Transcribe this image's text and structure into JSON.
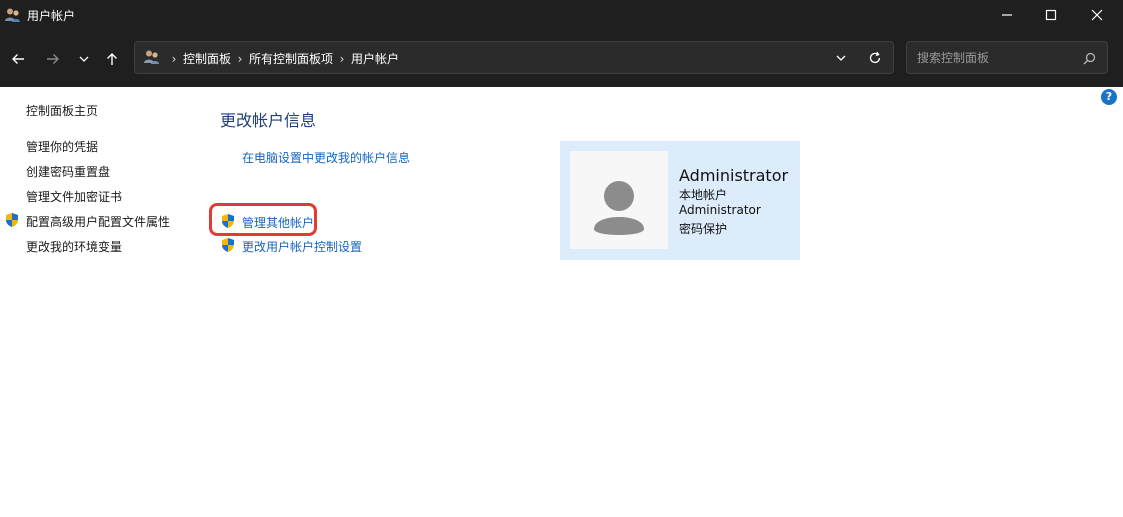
{
  "window": {
    "title": "用户帐户",
    "controls": {
      "minimize": "minimize",
      "maximize": "maximize",
      "close": "close"
    }
  },
  "address": {
    "breadcrumbs": [
      "控制面板",
      "所有控制面板项",
      "用户帐户"
    ]
  },
  "search": {
    "placeholder": "搜索控制面板"
  },
  "help": {
    "label": "?"
  },
  "sidebar": {
    "home": "控制面板主页",
    "items": [
      {
        "label": "管理你的凭据"
      },
      {
        "label": "创建密码重置盘"
      },
      {
        "label": "管理文件加密证书"
      },
      {
        "label": "配置高级用户配置文件属性",
        "icon": "uac-shield-icon"
      },
      {
        "label": "更改我的环境变量"
      }
    ]
  },
  "main": {
    "title": "更改帐户信息",
    "links": [
      {
        "label": "在电脑设置中更改我的帐户信息"
      },
      {
        "label": "管理其他帐户",
        "icon": "uac-shield-icon",
        "highlighted": true
      },
      {
        "label": "更改用户帐户控制设置",
        "icon": "uac-shield-icon"
      }
    ]
  },
  "account": {
    "name": "Administrator",
    "type": "本地帐户",
    "group": "Administrator",
    "status": "密码保护"
  },
  "colors": {
    "titlebar": "#1f1f1f",
    "link": "#1565c0",
    "heading": "#1e3f7a",
    "card": "#dcecfa",
    "highlight": "#e53935"
  }
}
